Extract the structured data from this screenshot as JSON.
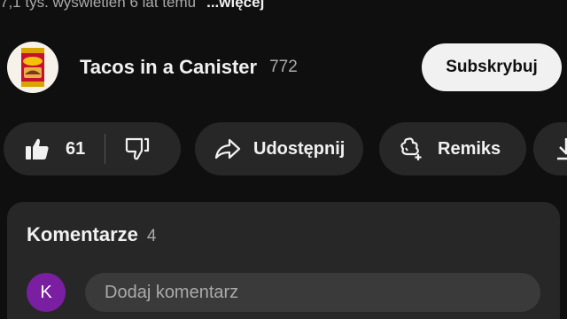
{
  "meta": {
    "views_time": "7,1 tys. wyświetleń  6 lat temu",
    "more_label": "...więcej"
  },
  "channel": {
    "avatar_icon": "canister-logo-icon",
    "name": "Tacos in a Canister",
    "subscriber_count": "772",
    "subscribe_label": "Subskrybuj"
  },
  "actions": {
    "like_count": "61",
    "like_icon": "thumbs-up-filled-icon",
    "dislike_icon": "thumbs-down-icon",
    "share_label": "Udostępnij",
    "share_icon": "share-arrow-icon",
    "remix_label": "Remiks",
    "remix_icon": "remix-icon",
    "download_icon": "download-icon"
  },
  "comments": {
    "title": "Komentarze",
    "count": "4",
    "user_initial": "K",
    "user_avatar_color": "#7b1fa2",
    "placeholder": "Dodaj komentarz"
  },
  "colors": {
    "background": "#0f0f0f",
    "pill": "#272727",
    "subscribe_bg": "#f1f1f1"
  }
}
